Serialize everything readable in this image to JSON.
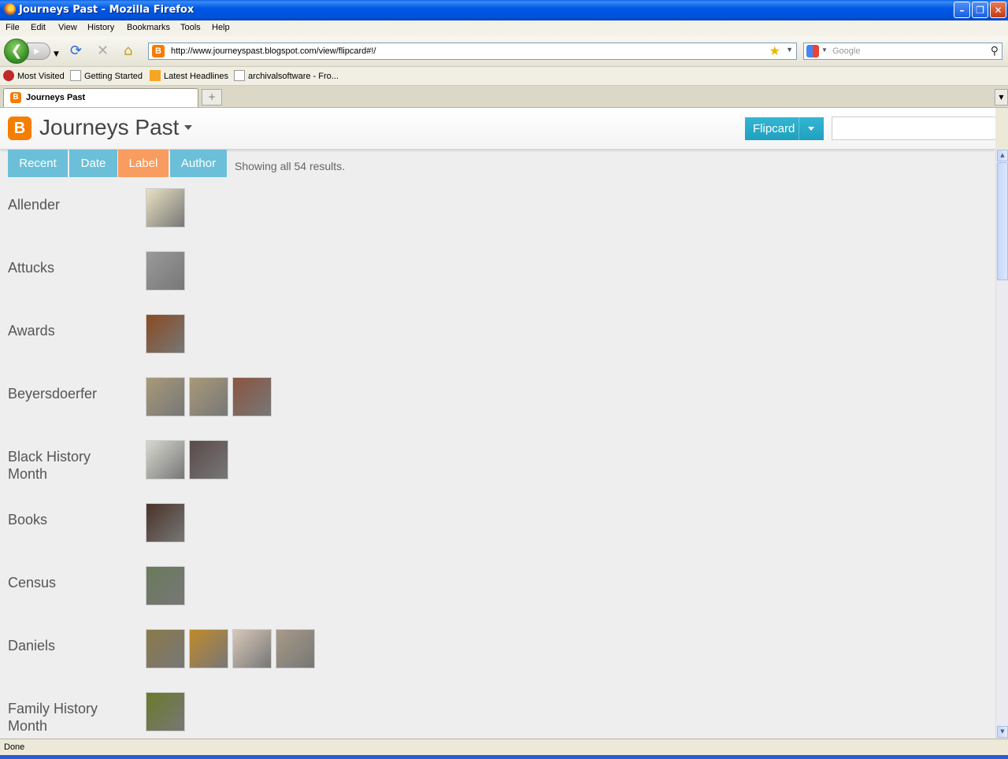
{
  "window": {
    "title": "Journeys Past - Mozilla Firefox"
  },
  "menu": [
    "File",
    "Edit",
    "View",
    "History",
    "Bookmarks",
    "Tools",
    "Help"
  ],
  "nav": {
    "url": "http://www.journeyspast.blogspot.com/view/flipcard#!/",
    "search_placeholder": "Google"
  },
  "bookmarks": [
    "Most Visited",
    "Getting Started",
    "Latest Headlines",
    "archivalsoftware - Fro..."
  ],
  "tab": {
    "label": "Journeys Past",
    "new_tab": "+"
  },
  "blog": {
    "title": "Journeys Past",
    "view_label": "Flipcard",
    "filters": [
      "Recent",
      "Date",
      "Label",
      "Author"
    ],
    "active_filter": "Label",
    "results": "Showing all 54 results."
  },
  "labels": [
    {
      "name": "Allender",
      "thumbs": [
        "#e9e2c2"
      ]
    },
    {
      "name": "Attucks",
      "thumbs": [
        "#9a9a9a"
      ]
    },
    {
      "name": "Awards",
      "thumbs": [
        "#8a4a22"
      ]
    },
    {
      "name": "Beyersdoerfer",
      "thumbs": [
        "#a89a78",
        "#a89a78",
        "#8a5540"
      ]
    },
    {
      "name": "Black History Month",
      "thumbs": [
        "#d8d8d0",
        "#5a4a4a"
      ]
    },
    {
      "name": "Books",
      "thumbs": [
        "#4a3228"
      ]
    },
    {
      "name": "Census",
      "thumbs": [
        "#6a7a5a"
      ]
    },
    {
      "name": "Daniels",
      "thumbs": [
        "#8a7a4a",
        "#c08a2a",
        "#d8c8b8",
        "#a89a88"
      ]
    },
    {
      "name": "Family History Month",
      "thumbs": [
        "#6a7a2a"
      ]
    }
  ],
  "status": "Done",
  "colors": {
    "filter_tab": "#6cbfd8",
    "filter_active": "#f89c5f",
    "view_button": "#22a6c6",
    "blogger_orange": "#f57d00"
  }
}
